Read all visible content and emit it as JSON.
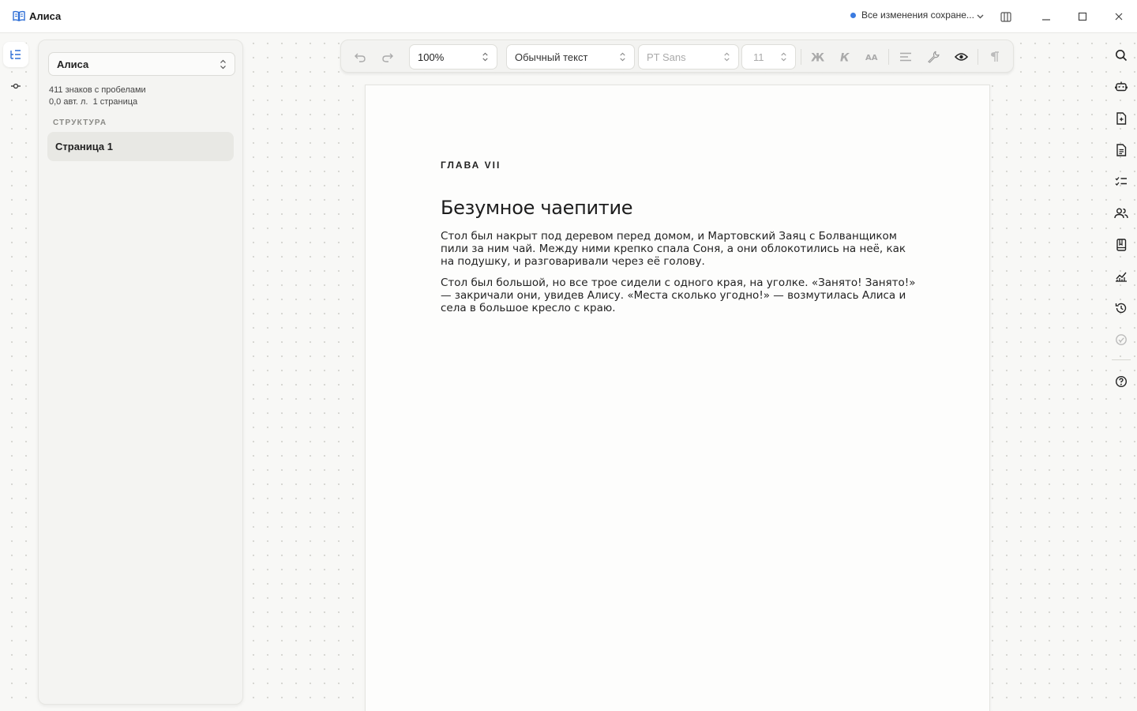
{
  "window": {
    "title": "Алиса",
    "save_status": "Все изменения сохране..."
  },
  "sidebar": {
    "document_select": "Алиса",
    "stats_line1": "411 знаков с пробелами",
    "stats_line2": "0,0 авт. л.  1 страница",
    "structure_label": "СТРУКТУРА",
    "pages": [
      {
        "label": "Страница 1"
      }
    ]
  },
  "toolbar": {
    "zoom": "100%",
    "paragraph_style": "Обычный текст",
    "font": "PT Sans",
    "font_size": "11"
  },
  "document": {
    "chapter": "ГЛАВА VII",
    "title": "Безумное чаепитие",
    "paragraphs": [
      "Стол был накрыт под деревом перед домом, и Мартовский Заяц с Болванщиком пили за ним чай. Между ними крепко спала Соня, а они облокотились на неё, как на подушку, и разговаривали через её голову.",
      "Стол был большой, но все трое сидели с одного края, на уголке. «Занято! Занято!» — закричали они, увидев Алису. «Места сколько угодно!» — возмутилась Алиса и села в большое кресло с краю."
    ]
  },
  "colors": {
    "accent": "#3b7be0",
    "page_bg": "#fdfdfc",
    "canvas_bg": "#f8f8f6"
  },
  "icons": {
    "left_rail": [
      "outline-icon",
      "commit-icon"
    ],
    "right_rail": [
      "search-icon",
      "robot-icon",
      "document-add-icon",
      "document-icon",
      "checklist-icon",
      "users-icon",
      "book-icon",
      "chart-icon",
      "history-icon",
      "check-circle-icon",
      "help-icon"
    ]
  }
}
